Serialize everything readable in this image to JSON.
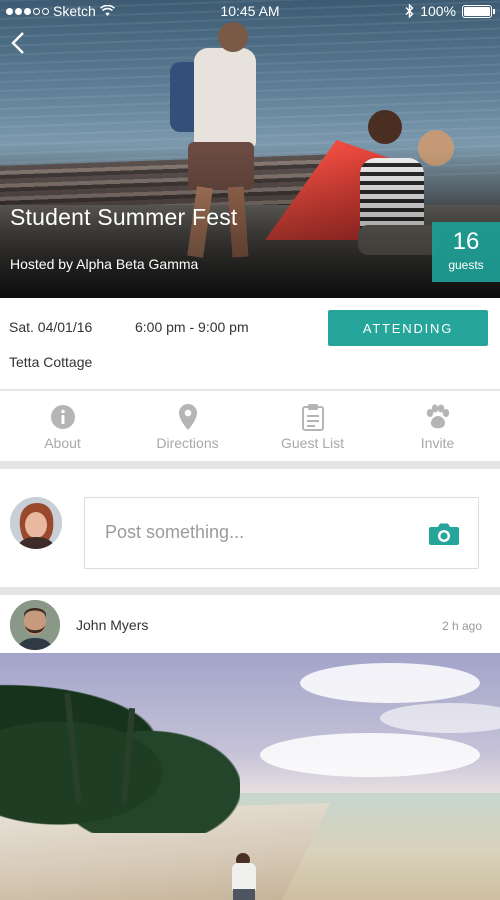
{
  "status_bar": {
    "carrier": "Sketch",
    "time": "10:45 AM",
    "battery": "100%"
  },
  "event": {
    "title": "Student Summer Fest",
    "host": "Hosted by Alpha Beta Gamma",
    "guest_count": "16",
    "guest_label": "guests",
    "date": "Sat. 04/01/16",
    "time_range": "6:00 pm - 9:00 pm",
    "venue": "Tetta Cottage",
    "attend_label": "ATTENDING"
  },
  "actions": [
    {
      "label": "About",
      "icon": "info-icon"
    },
    {
      "label": "Directions",
      "icon": "map-pin-icon"
    },
    {
      "label": "Guest List",
      "icon": "clipboard-icon"
    },
    {
      "label": "Invite",
      "icon": "paw-icon"
    }
  ],
  "composer": {
    "placeholder": "Post something..."
  },
  "feed": [
    {
      "author": "John Myers",
      "time": "2 h ago"
    }
  ],
  "colors": {
    "accent": "#26a69a",
    "muted_text": "#a8a8a8",
    "divider": "#e5e5e5"
  }
}
